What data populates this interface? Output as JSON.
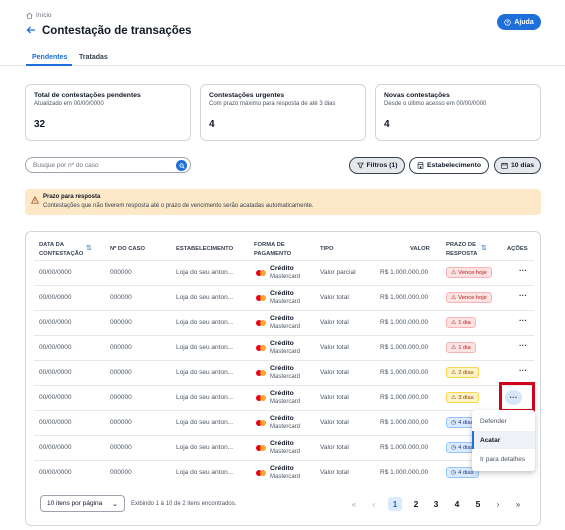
{
  "breadcrumb": {
    "label": "Início"
  },
  "page": {
    "title": "Contestação de transações",
    "help_label": "Ajuda"
  },
  "tabs": [
    {
      "label": "Pendentes"
    },
    {
      "label": "Tratadas"
    }
  ],
  "cards": [
    {
      "title": "Total de contestações pendentes",
      "subtitle": "Atualizado em 00/00/0000",
      "value": "32"
    },
    {
      "title": "Contestações urgentes",
      "subtitle": "Com prazo máximo para resposta de até 3 dias",
      "value": "4"
    },
    {
      "title": "Novas contestações",
      "subtitle": "Desde o último acesso em 00/00/0000",
      "value": "4"
    }
  ],
  "search": {
    "placeholder": "Busque por nº do caso"
  },
  "filters": {
    "filters_label": "Filtros (1)",
    "establishment_label": "Estabelecimento",
    "days_label": "10 dias"
  },
  "alert": {
    "title": "Prazo para resposta",
    "text": "Contestações que não tiverem resposta até o prazo de vencimento serão acatadas automaticamente."
  },
  "table": {
    "headers": {
      "date_line1": "DATA DA",
      "date_line2": "CONTESTAÇÃO",
      "case": "Nº DO CASO",
      "establishment": "ESTABELECIMENTO",
      "payment_line1": "FORMA DE",
      "payment_line2": "PAGAMENTO",
      "type": "TIPO",
      "value": "VALOR",
      "deadline_line1": "PRAZO DE",
      "deadline_line2": "RESPOSTA",
      "actions": "AÇÕES"
    },
    "rows": [
      {
        "date": "00/00/0000",
        "case": "000000",
        "establishment": "Loja do seu anton...",
        "payment": "Crédito",
        "brand": "Mastercard",
        "type": "Valor parcial",
        "value": "R$ 1.000.000,00",
        "deadline": "Vence hoje",
        "status": "red"
      },
      {
        "date": "00/00/0000",
        "case": "000000",
        "establishment": "Loja do seu anton...",
        "payment": "Crédito",
        "brand": "Mastercard",
        "type": "Valor total",
        "value": "R$ 1.000.000,00",
        "deadline": "Vence hoje",
        "status": "red"
      },
      {
        "date": "00/00/0000",
        "case": "000000",
        "establishment": "Loja do seu anton...",
        "payment": "Crédito",
        "brand": "Mastercard",
        "type": "Valor total",
        "value": "R$ 1.000.000,00",
        "deadline": "1 dia",
        "status": "red"
      },
      {
        "date": "00/00/0000",
        "case": "000000",
        "establishment": "Loja do seu anton...",
        "payment": "Crédito",
        "brand": "Mastercard",
        "type": "Valor total",
        "value": "R$ 1.000.000,00",
        "deadline": "1 dia",
        "status": "red"
      },
      {
        "date": "00/00/0000",
        "case": "000000",
        "establishment": "Loja do seu anton...",
        "payment": "Crédito",
        "brand": "Mastercard",
        "type": "Valor total",
        "value": "R$ 1.000.000,00",
        "deadline": "2 dias",
        "status": "yellow"
      },
      {
        "date": "00/00/0000",
        "case": "000000",
        "establishment": "Loja do seu anton...",
        "payment": "Crédito",
        "brand": "Mastercard",
        "type": "Valor total",
        "value": "R$ 1.000.000,00",
        "deadline": "3 dias",
        "status": "yellow"
      },
      {
        "date": "00/00/0000",
        "case": "000000",
        "establishment": "Loja do seu anton...",
        "payment": "Crédito",
        "brand": "Mastercard",
        "type": "Valor total",
        "value": "R$ 1.000.000,00",
        "deadline": "4 dias",
        "status": "blue"
      },
      {
        "date": "00/00/0000",
        "case": "000000",
        "establishment": "Loja do seu anton...",
        "payment": "Crédito",
        "brand": "Mastercard",
        "type": "Valor total",
        "value": "R$ 1.000.000,00",
        "deadline": "4 dias",
        "status": "blue"
      },
      {
        "date": "00/00/0000",
        "case": "000000",
        "establishment": "Loja do seu anton...",
        "payment": "Crédito",
        "brand": "Mastercard",
        "type": "Valor total",
        "value": "R$ 1.000.000,00",
        "deadline": "4 dias",
        "status": "blue"
      }
    ],
    "actions_symbol": "···"
  },
  "row_menu": {
    "items": [
      {
        "label": "Defender"
      },
      {
        "label": "Acatar"
      },
      {
        "label": "Ir para detalhes"
      }
    ]
  },
  "pagination": {
    "per_page": "10 itens por página",
    "info": "Exibindo 1 à 10 de 2 itens encontrados.",
    "first": "«",
    "prev": "‹",
    "next": "›",
    "last": "»",
    "pages": [
      "1",
      "2",
      "3",
      "4",
      "5"
    ],
    "current_page": "1"
  },
  "colors": {
    "accent": "#1e6fd9",
    "alert_bg": "#fde8c8",
    "highlight": "#d0021b"
  }
}
